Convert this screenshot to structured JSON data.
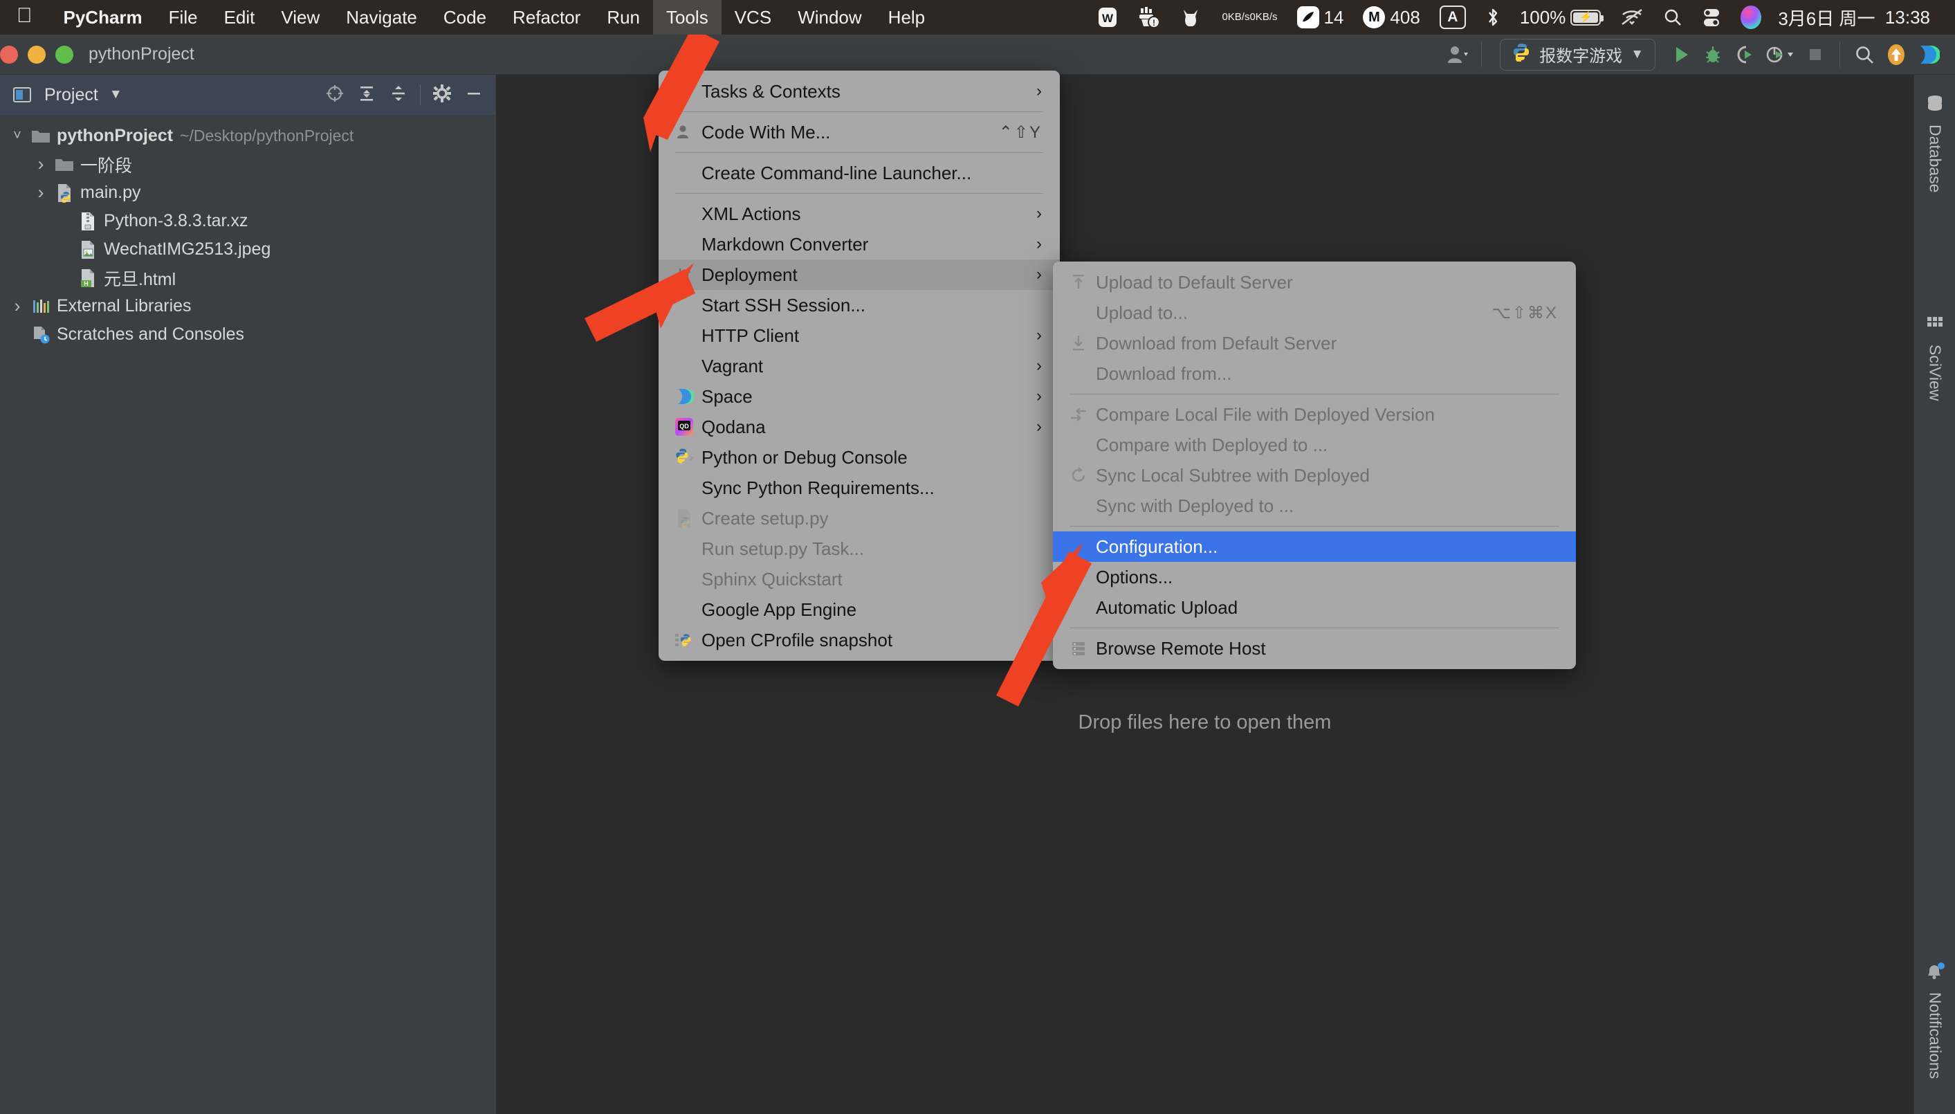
{
  "macbar": {
    "apple_icon": "apple-logo",
    "items": [
      {
        "label": "PyCharm",
        "bold": true,
        "active": false
      },
      {
        "label": "File",
        "bold": false,
        "active": false
      },
      {
        "label": "Edit",
        "bold": false,
        "active": false
      },
      {
        "label": "View",
        "bold": false,
        "active": false
      },
      {
        "label": "Navigate",
        "bold": false,
        "active": false
      },
      {
        "label": "Code",
        "bold": false,
        "active": false
      },
      {
        "label": "Refactor",
        "bold": false,
        "active": false
      },
      {
        "label": "Run",
        "bold": false,
        "active": false
      },
      {
        "label": "Tools",
        "bold": false,
        "active": true
      },
      {
        "label": "VCS",
        "bold": false,
        "active": false
      },
      {
        "label": "Window",
        "bold": false,
        "active": false
      },
      {
        "label": "Help",
        "bold": false,
        "active": false
      }
    ],
    "tray": {
      "wps_icon": "wps-office-icon",
      "cleaner_icon": "cleaner-icon",
      "cat_icon": "cat-icon",
      "net_up": "0KB/s",
      "net_down": "0KB/s",
      "swift_badge": "14",
      "swift_icon": "feather-icon",
      "m_badge": "408",
      "m_icon": "m-circle-icon",
      "input_source": "A",
      "bluetooth_icon": "bluetooth-icon",
      "battery_percent": "100%",
      "battery_icon": "battery-charging-icon",
      "wifi_icon": "wifi-off-icon",
      "search_icon": "search-icon",
      "control_center_icon": "control-center-icon",
      "siri_icon": "siri-icon",
      "date": "3月6日 周一",
      "time": "13:38"
    }
  },
  "titlebar": {
    "project_name": "pythonProject",
    "user_icon": "user-avatar-icon",
    "run_config": "报数字游戏",
    "run_config_icon": "python-file-icon",
    "run_icon": "run-play-icon",
    "debug_icon": "debug-bug-icon",
    "run_coverage_icon": "run-with-coverage-icon",
    "profile_icon": "profile-icon",
    "stop_icon": "stop-square-icon",
    "search_icon": "search-everywhere-icon",
    "update_icon": "update-project-icon",
    "space_icon": "jetbrains-space-icon"
  },
  "project_panel": {
    "title": "Project",
    "dropdown_icon": "chevron-down-icon",
    "panel_icon": "project-window-icon",
    "icons": [
      {
        "name": "scroll-from-source-icon"
      },
      {
        "name": "expand-all-icon"
      },
      {
        "name": "collapse-all-icon"
      },
      {
        "name": "settings-gear-icon"
      },
      {
        "name": "hide-panel-icon"
      }
    ],
    "tree": [
      {
        "label": "pythonProject",
        "path": "~/Desktop/pythonProject",
        "icon": "folder-icon",
        "chevron": "down",
        "indent": 0,
        "bold": true
      },
      {
        "label": "一阶段",
        "path": "",
        "icon": "folder-icon",
        "chevron": "right",
        "indent": 1,
        "bold": false
      },
      {
        "label": "main.py",
        "path": "",
        "icon": "python-file-icon",
        "chevron": "right",
        "indent": 1,
        "bold": false
      },
      {
        "label": "Python-3.8.3.tar.xz",
        "path": "",
        "icon": "archive-file-icon",
        "chevron": "none",
        "indent": 2,
        "bold": false
      },
      {
        "label": "WechatIMG2513.jpeg",
        "path": "",
        "icon": "image-file-icon",
        "chevron": "none",
        "indent": 2,
        "bold": false
      },
      {
        "label": "元旦.html",
        "path": "",
        "icon": "html-file-icon",
        "chevron": "none",
        "indent": 2,
        "bold": false
      },
      {
        "label": "External Libraries",
        "path": "",
        "icon": "library-icon",
        "chevron": "right",
        "indent": 0,
        "bold": false
      },
      {
        "label": "Scratches and Consoles",
        "path": "",
        "icon": "scratches-icon",
        "chevron": "none",
        "indent": 0,
        "bold": false
      }
    ]
  },
  "editor": {
    "drop_hint": "Drop files here to open them"
  },
  "right_stripe": [
    {
      "label": "Database",
      "icon": "database-icon"
    },
    {
      "label": "SciView",
      "icon": "sciview-grid-icon"
    },
    {
      "label": "Notifications",
      "icon": "bell-icon"
    }
  ],
  "tools_menu": {
    "items": [
      {
        "label": "Tasks & Contexts",
        "icon": "",
        "arrow": true,
        "shortcut": "",
        "state": "normal"
      },
      {
        "separator": true
      },
      {
        "label": "Code With Me...",
        "icon": "person-icon",
        "arrow": false,
        "shortcut": "⌃⇧Y",
        "state": "normal"
      },
      {
        "separator": true
      },
      {
        "label": "Create Command-line Launcher...",
        "icon": "",
        "arrow": false,
        "shortcut": "",
        "state": "normal"
      },
      {
        "separator": true
      },
      {
        "label": "XML Actions",
        "icon": "",
        "arrow": true,
        "shortcut": "",
        "state": "normal"
      },
      {
        "label": "Markdown Converter",
        "icon": "",
        "arrow": true,
        "shortcut": "",
        "state": "normal"
      },
      {
        "label": "Deployment",
        "icon": "deployment-updown-icon",
        "arrow": true,
        "shortcut": "",
        "state": "highlighted"
      },
      {
        "label": "Start SSH Session...",
        "icon": "",
        "arrow": false,
        "shortcut": "",
        "state": "normal"
      },
      {
        "label": "HTTP Client",
        "icon": "",
        "arrow": true,
        "shortcut": "",
        "state": "normal"
      },
      {
        "label": "Vagrant",
        "icon": "",
        "arrow": true,
        "shortcut": "",
        "state": "normal"
      },
      {
        "label": "Space",
        "icon": "jetbrains-space-icon",
        "arrow": true,
        "shortcut": "",
        "state": "normal"
      },
      {
        "label": "Qodana",
        "icon": "qodana-icon",
        "arrow": true,
        "shortcut": "",
        "state": "normal"
      },
      {
        "label": "Python or Debug Console",
        "icon": "python-console-icon",
        "arrow": false,
        "shortcut": "",
        "state": "normal"
      },
      {
        "label": "Sync Python Requirements...",
        "icon": "",
        "arrow": false,
        "shortcut": "",
        "state": "normal"
      },
      {
        "label": "Create setup.py",
        "icon": "python-file-icon",
        "arrow": false,
        "shortcut": "",
        "state": "disabled"
      },
      {
        "label": "Run setup.py Task...",
        "icon": "",
        "arrow": false,
        "shortcut": "",
        "state": "disabled"
      },
      {
        "label": "Sphinx Quickstart",
        "icon": "",
        "arrow": false,
        "shortcut": "",
        "state": "disabled"
      },
      {
        "label": "Google App Engine",
        "icon": "",
        "arrow": false,
        "shortcut": "",
        "state": "normal"
      },
      {
        "label": "Open CProfile snapshot",
        "icon": "cprofile-icon",
        "arrow": false,
        "shortcut": "",
        "state": "normal"
      }
    ]
  },
  "deployment_menu": {
    "items": [
      {
        "label": "Upload to Default Server",
        "icon": "upload-icon",
        "shortcut": "",
        "state": "disabled"
      },
      {
        "label": "Upload to...",
        "icon": "",
        "shortcut": "⌥⇧⌘X",
        "state": "disabled"
      },
      {
        "label": "Download from Default Server",
        "icon": "download-icon",
        "shortcut": "",
        "state": "disabled"
      },
      {
        "label": "Download from...",
        "icon": "",
        "shortcut": "",
        "state": "disabled"
      },
      {
        "separator": true
      },
      {
        "label": "Compare Local File with Deployed Version",
        "icon": "compare-icon",
        "shortcut": "",
        "state": "disabled"
      },
      {
        "label": "Compare with Deployed to ...",
        "icon": "",
        "shortcut": "",
        "state": "disabled"
      },
      {
        "label": "Sync Local Subtree with Deployed",
        "icon": "sync-icon",
        "shortcut": "",
        "state": "disabled"
      },
      {
        "label": "Sync with Deployed to ...",
        "icon": "",
        "shortcut": "",
        "state": "disabled"
      },
      {
        "separator": true
      },
      {
        "label": "Configuration...",
        "icon": "",
        "shortcut": "",
        "state": "selected"
      },
      {
        "label": "Options...",
        "icon": "",
        "shortcut": "",
        "state": "normal"
      },
      {
        "label": "Automatic Upload",
        "icon": "",
        "shortcut": "",
        "state": "normal"
      },
      {
        "separator": true
      },
      {
        "label": "Browse Remote Host",
        "icon": "remote-host-icon",
        "shortcut": "",
        "state": "normal"
      }
    ]
  },
  "annotations": {
    "accent_color": "#ef4123",
    "arrows": [
      {
        "name": "arrow-to-tools-menu"
      },
      {
        "name": "arrow-to-deployment-item"
      },
      {
        "name": "arrow-to-configuration-item"
      }
    ]
  }
}
